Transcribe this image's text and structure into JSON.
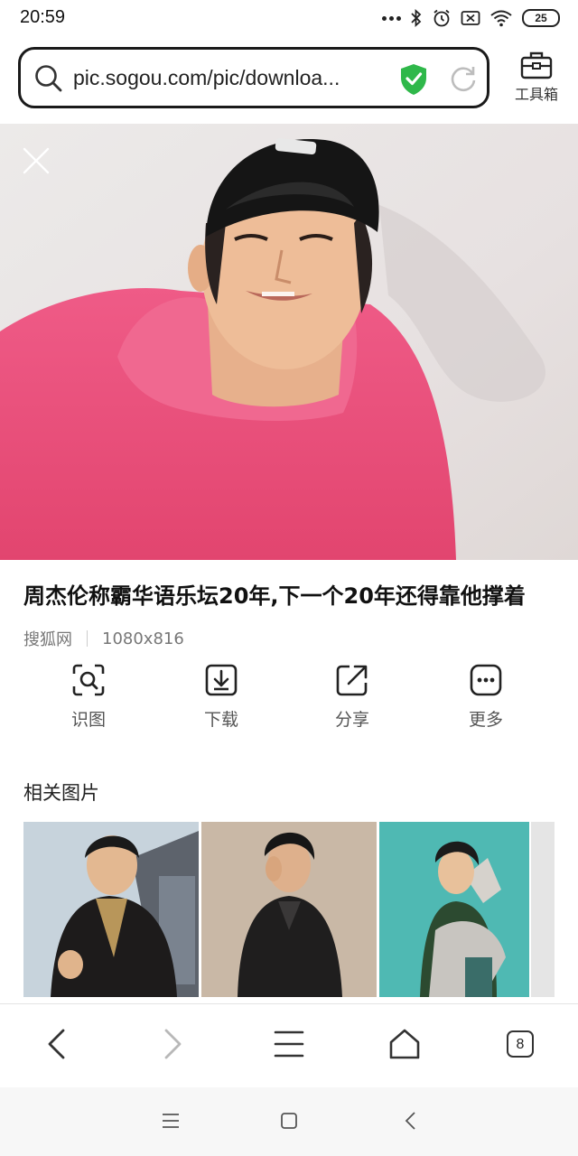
{
  "status_bar": {
    "time": "20:59",
    "battery": "25",
    "icons": [
      "more-dots-icon",
      "bluetooth-icon",
      "alarm-icon",
      "sim-off-icon",
      "wifi-icon",
      "battery-icon"
    ]
  },
  "url_bar": {
    "url": "pic.sogou.com/pic/downloa...",
    "secure_color": "#2fb84a"
  },
  "toolbox": {
    "label": "工具箱"
  },
  "image": {
    "title": "周杰伦称霸华语乐坛20年,下一个20年还得靠他撑着",
    "source": "搜狐网",
    "dimensions": "1080x816"
  },
  "actions": [
    {
      "label": "识图",
      "icon": "image-search-icon"
    },
    {
      "label": "下载",
      "icon": "download-icon"
    },
    {
      "label": "分享",
      "icon": "share-icon"
    },
    {
      "label": "更多",
      "icon": "more-icon"
    }
  ],
  "related": {
    "title": "相关图片"
  },
  "bottom_nav": {
    "tab_count": "8"
  }
}
